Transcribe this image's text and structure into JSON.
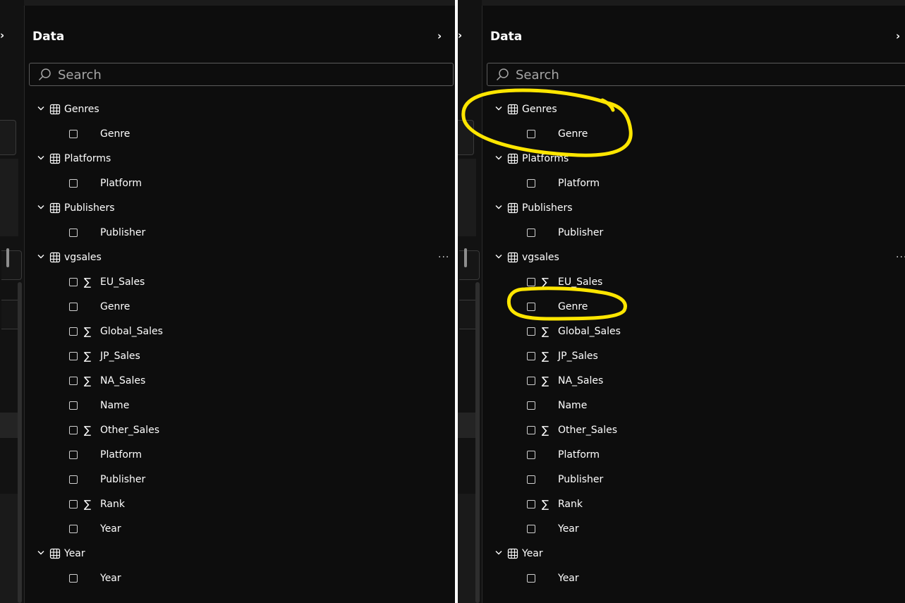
{
  "panes": [
    {
      "id": "left",
      "title": "Data",
      "search_placeholder": "Search",
      "tables": [
        {
          "name": "Genres",
          "fields": [
            {
              "name": "Genre",
              "sigma": false
            }
          ]
        },
        {
          "name": "Platforms",
          "fields": [
            {
              "name": "Platform",
              "sigma": false
            }
          ]
        },
        {
          "name": "Publishers",
          "fields": [
            {
              "name": "Publisher",
              "sigma": false
            }
          ]
        },
        {
          "name": "vgsales",
          "more": "···",
          "fields": [
            {
              "name": "EU_Sales",
              "sigma": true
            },
            {
              "name": "Genre",
              "sigma": false
            },
            {
              "name": "Global_Sales",
              "sigma": true
            },
            {
              "name": "JP_Sales",
              "sigma": true
            },
            {
              "name": "NA_Sales",
              "sigma": true
            },
            {
              "name": "Name",
              "sigma": false
            },
            {
              "name": "Other_Sales",
              "sigma": true
            },
            {
              "name": "Platform",
              "sigma": false
            },
            {
              "name": "Publisher",
              "sigma": false
            },
            {
              "name": "Rank",
              "sigma": true
            },
            {
              "name": "Year",
              "sigma": false
            }
          ]
        },
        {
          "name": "Year",
          "fields": [
            {
              "name": "Year",
              "sigma": false
            }
          ]
        }
      ]
    },
    {
      "id": "right",
      "title": "Data",
      "search_placeholder": "Search",
      "tables": [
        {
          "name": "Genres",
          "fields": [
            {
              "name": "Genre",
              "sigma": false
            }
          ]
        },
        {
          "name": "Platforms",
          "fields": [
            {
              "name": "Platform",
              "sigma": false
            }
          ]
        },
        {
          "name": "Publishers",
          "fields": [
            {
              "name": "Publisher",
              "sigma": false
            }
          ]
        },
        {
          "name": "vgsales",
          "more": "···",
          "fields": [
            {
              "name": "EU_Sales",
              "sigma": true
            },
            {
              "name": "Genre",
              "sigma": false
            },
            {
              "name": "Global_Sales",
              "sigma": true
            },
            {
              "name": "JP_Sales",
              "sigma": true
            },
            {
              "name": "NA_Sales",
              "sigma": true
            },
            {
              "name": "Name",
              "sigma": false
            },
            {
              "name": "Other_Sales",
              "sigma": true
            },
            {
              "name": "Platform",
              "sigma": false
            },
            {
              "name": "Publisher",
              "sigma": false
            },
            {
              "name": "Rank",
              "sigma": true
            },
            {
              "name": "Year",
              "sigma": false
            }
          ]
        },
        {
          "name": "Year",
          "fields": [
            {
              "name": "Year",
              "sigma": false
            }
          ]
        }
      ]
    }
  ],
  "glyphs": {
    "collapse": "›",
    "expand": "›",
    "sigma": "∑"
  },
  "colors": {
    "panel_bg": "#0d0d0d",
    "text": "#ffffff",
    "highlight": "#ffe600"
  }
}
